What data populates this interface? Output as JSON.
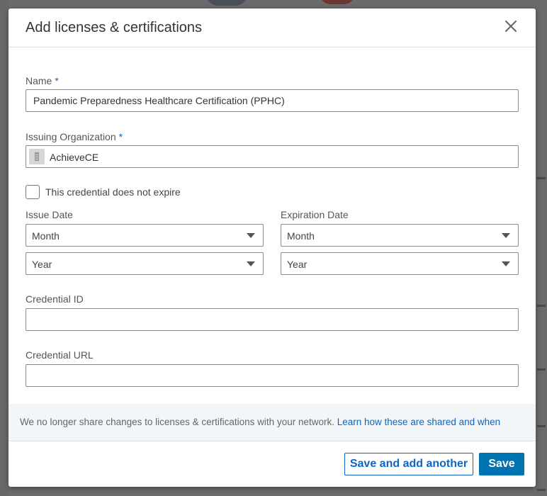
{
  "dialog": {
    "title": "Add licenses & certifications",
    "close_icon": "close-icon"
  },
  "form": {
    "name": {
      "label": "Name",
      "required_mark": "*",
      "value": "Pandemic Preparedness Healthcare Certification (PPHC)"
    },
    "issuing_organization": {
      "label": "Issuing Organization",
      "required_mark": "*",
      "value": "AchieveCE",
      "logo_icon": "building-icon"
    },
    "no_expire": {
      "label": "This credential does not expire",
      "checked": false
    },
    "issue_date": {
      "label": "Issue Date",
      "month": "Month",
      "year": "Year"
    },
    "expiration_date": {
      "label": "Expiration Date",
      "month": "Month",
      "year": "Year"
    },
    "credential_id": {
      "label": "Credential ID",
      "value": ""
    },
    "credential_url": {
      "label": "Credential URL",
      "value": ""
    }
  },
  "share_note": {
    "text": "We no longer share changes to licenses & certifications with your network.",
    "link": "Learn how these are shared and when"
  },
  "footer": {
    "save_add_another": "Save and add another",
    "save": "Save"
  },
  "colors": {
    "accent": "#0a66c2",
    "primary_button": "#0073b1",
    "note_background": "#f3f6f8"
  }
}
